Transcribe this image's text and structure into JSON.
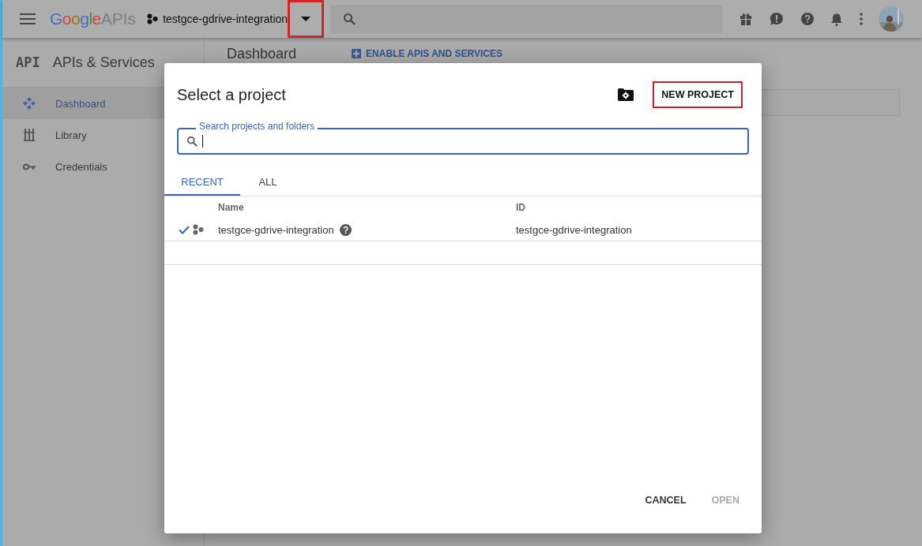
{
  "topbar": {
    "logo_brand": "Google",
    "logo_product": "APIs",
    "project": "testgce-gdrive-integration",
    "dropdown_highlighted": true
  },
  "sidebar": {
    "badge": "API",
    "title": "APIs & Services",
    "items": [
      {
        "label": "Dashboard",
        "kind": "dashboard",
        "selected": true
      },
      {
        "label": "Library",
        "kind": "library",
        "selected": false
      },
      {
        "label": "Credentials",
        "kind": "key",
        "selected": false
      }
    ]
  },
  "content": {
    "title": "Dashboard",
    "action": "ENABLE APIS AND SERVICES"
  },
  "dialog": {
    "title": "Select a project",
    "new_project": {
      "label": "NEW PROJECT",
      "highlighted": true
    },
    "search": {
      "label": "Search projects and folders"
    },
    "tabs": [
      {
        "label": "RECENT",
        "selected": true
      },
      {
        "label": "ALL",
        "selected": false
      }
    ],
    "table": {
      "columns": [
        "Name",
        "ID"
      ],
      "rows": [
        {
          "checked": true,
          "name": "testgce-gdrive-integration",
          "id": "testgce-gdrive-integration"
        }
      ]
    },
    "buttons": [
      {
        "label": "CANCEL",
        "disabled": false
      },
      {
        "label": "OPEN",
        "disabled": true
      }
    ]
  }
}
